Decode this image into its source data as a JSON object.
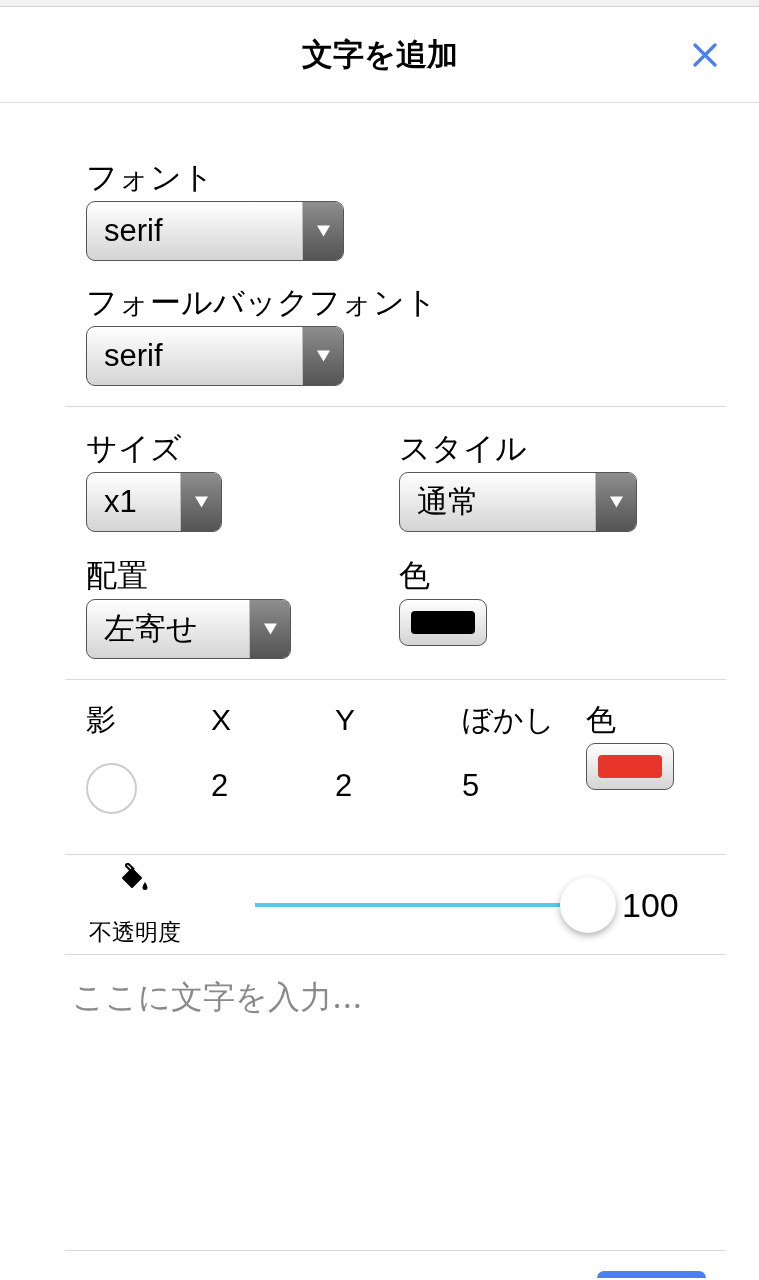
{
  "header": {
    "title": "文字を追加"
  },
  "font": {
    "fields": [
      {
        "label": "フォント",
        "value": "serif"
      },
      {
        "label": "フォールバックフォント",
        "value": "serif"
      }
    ]
  },
  "format": {
    "fields": [
      {
        "kind": "select",
        "label": "サイズ",
        "value": "x1"
      },
      {
        "kind": "select",
        "label": "スタイル",
        "value": "通常"
      },
      {
        "kind": "select",
        "label": "配置",
        "value": "左寄せ"
      },
      {
        "kind": "color",
        "label": "色",
        "color": "#000000"
      }
    ]
  },
  "shadow": {
    "label": "影",
    "checked": false,
    "params": [
      {
        "label": "X",
        "value": "2"
      },
      {
        "label": "Y",
        "value": "2"
      },
      {
        "label": "ぼかし",
        "value": "5"
      }
    ],
    "color_label": "色",
    "color": "#e8352a"
  },
  "opacity": {
    "label": "不透明度",
    "level": 1,
    "reading": "100"
  },
  "text_input": {
    "placeholder": "ここに文字を入力..."
  }
}
